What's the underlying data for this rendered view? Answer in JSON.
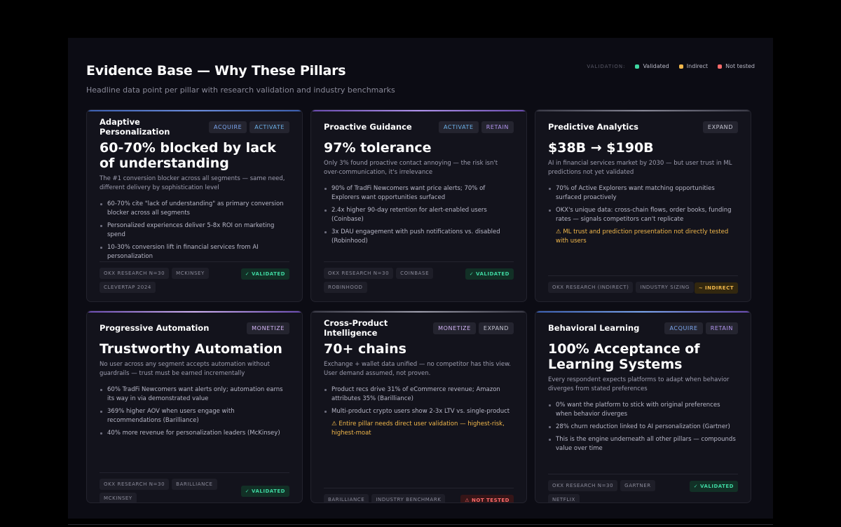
{
  "page": {
    "title": "Evidence Base — Why These Pillars",
    "subtitle": "Headline data point per pillar with research validation and industry benchmarks"
  },
  "legend": {
    "label": "VALIDATION:",
    "items": [
      {
        "label": "Validated",
        "color": "#3ed6a0"
      },
      {
        "label": "Indirect",
        "color": "#f2b84b"
      },
      {
        "label": "Not tested",
        "color": "#ff6b6b"
      }
    ]
  },
  "cards": [
    {
      "name": "Adaptive Personalization",
      "tags": [
        "ACQUIRE",
        "ACTIVATE"
      ],
      "headline": "60-70% blocked by lack of understanding",
      "description": "The #1 conversion blocker across all segments — same need, different delivery by sophistication level",
      "bullets": [
        "60-70% cite \"lack of understanding\" as primary conversion blocker across all segments",
        "Personalized experiences deliver 5-8x ROI on marketing spend",
        "10-30% conversion lift in financial services from AI personalization"
      ],
      "sources": [
        "OKX RESEARCH N=30",
        "MCKINSEY",
        "CLEVERTAP 2024"
      ],
      "status": "✓ VALIDATED"
    },
    {
      "name": "Proactive Guidance",
      "tags": [
        "ACTIVATE",
        "RETAIN"
      ],
      "headline": "97% tolerance",
      "description": "Only 3% found proactive contact annoying — the risk isn't over-communication, it's irrelevance",
      "bullets": [
        "90% of TradFi Newcomers want price alerts; 70% of Explorers want opportunities surfaced",
        "2.4x higher 90-day retention for alert-enabled users (Coinbase)",
        "3x DAU engagement with push notifications vs. disabled (Robinhood)"
      ],
      "sources": [
        "OKX RESEARCH N=30",
        "COINBASE",
        "ROBINHOOD"
      ],
      "status": "✓ VALIDATED"
    },
    {
      "name": "Predictive Analytics",
      "tags": [
        "EXPAND"
      ],
      "headline": "$38B → $190B",
      "description": "AI in financial services market by 2030 — but user trust in ML predictions not yet validated",
      "bullets": [
        "70% of Active Explorers want matching opportunities surfaced proactively",
        "OKX's unique data: cross-chain flows, order books, funding rates — signals competitors can't replicate"
      ],
      "warning": "⚠ ML trust and prediction presentation not directly tested with users",
      "sources": [
        "OKX RESEARCH (INDIRECT)",
        "INDUSTRY SIZING"
      ],
      "status": "~ INDIRECT"
    },
    {
      "name": "Progressive Automation",
      "tags": [
        "MONETIZE"
      ],
      "headline": "Trustworthy Automation",
      "description": "No user across any segment accepts automation without guardrails — trust must be earned incrementally",
      "bullets": [
        "60% TradFi Newcomers want alerts only; automation earns its way in via demonstrated value",
        "369% higher AOV when users engage with recommendations (Barilliance)",
        "40% more revenue for personalization leaders (McKinsey)"
      ],
      "sources": [
        "OKX RESEARCH N=30",
        "BARILLIANCE",
        "MCKINSEY"
      ],
      "status": "✓ VALIDATED"
    },
    {
      "name": "Cross-Product Intelligence",
      "tags": [
        "MONETIZE",
        "EXPAND"
      ],
      "headline": "70+ chains",
      "description": "Exchange + wallet data unified — no competitor has this view. User demand assumed, not proven.",
      "bullets": [
        "Product recs drive 31% of eCommerce revenue; Amazon attributes 35% (Barilliance)",
        "Multi-product crypto users show 2-3x LTV vs. single-product"
      ],
      "warning": "⚠ Entire pillar needs direct user validation — highest-risk, highest-moat",
      "sources": [
        "BARILLIANCE",
        "INDUSTRY BENCHMARK"
      ],
      "status": "⚠ NOT TESTED"
    },
    {
      "name": "Behavioral Learning",
      "tags": [
        "ACQUIRE",
        "RETAIN"
      ],
      "headline": "100% Acceptance of Learning Systems",
      "description": "Every respondent expects platforms to adapt when behavior diverges from stated preferences",
      "bullets": [
        "0% want the platform to stick with original preferences when behavior diverges",
        "28% churn reduction linked to AI personalization (Gartner)",
        "This is the engine underneath all other pillars — compounds value over time"
      ],
      "sources": [
        "OKX RESEARCH N=30",
        "GARTNER",
        "NETFLIX"
      ],
      "status": "✓ VALIDATED"
    }
  ]
}
